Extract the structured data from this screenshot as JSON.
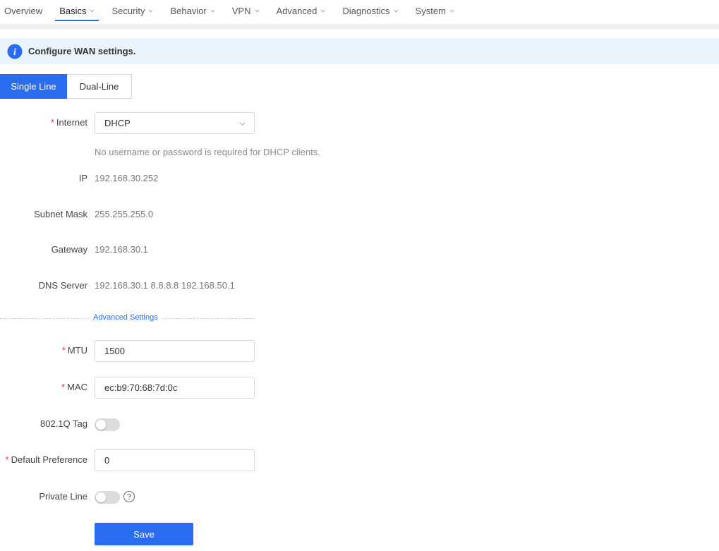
{
  "nav": {
    "items": [
      {
        "label": "Overview",
        "has_menu": false,
        "active": false
      },
      {
        "label": "Basics",
        "has_menu": true,
        "active": true
      },
      {
        "label": "Security",
        "has_menu": true,
        "active": false
      },
      {
        "label": "Behavior",
        "has_menu": true,
        "active": false
      },
      {
        "label": "VPN",
        "has_menu": true,
        "active": false
      },
      {
        "label": "Advanced",
        "has_menu": true,
        "active": false
      },
      {
        "label": "Diagnostics",
        "has_menu": true,
        "active": false
      },
      {
        "label": "System",
        "has_menu": true,
        "active": false
      }
    ]
  },
  "banner": {
    "text": "Configure WAN settings.",
    "icon": "info-icon"
  },
  "line_tabs": {
    "single": "Single Line",
    "dual": "Dual-Line"
  },
  "form": {
    "internet": {
      "label": "Internet",
      "value": "DHCP",
      "hint": "No username or password is required for DHCP clients."
    },
    "ip": {
      "label": "IP",
      "value": "192.168.30.252"
    },
    "subnet": {
      "label": "Subnet Mask",
      "value": "255.255.255.0"
    },
    "gateway": {
      "label": "Gateway",
      "value": "192.168.30.1"
    },
    "dns": {
      "label": "DNS Server",
      "value": "192.168.30.1 8.8.8.8 192.168.50.1"
    },
    "advanced_link": "Advanced Settings",
    "mtu": {
      "label": "MTU",
      "value": "1500"
    },
    "mac": {
      "label": "MAC",
      "value": "ec:b9:70:68:7d:0c"
    },
    "vlan_tag": {
      "label": "802.1Q Tag",
      "enabled": false
    },
    "default_pref": {
      "label": "Default Preference",
      "value": "0"
    },
    "private_line": {
      "label": "Private Line",
      "enabled": false
    },
    "required_mark": "*",
    "save": "Save"
  },
  "colors": {
    "accent": "#2a6cf0",
    "banner_bg": "#e9f4fd",
    "required": "#e34444"
  }
}
